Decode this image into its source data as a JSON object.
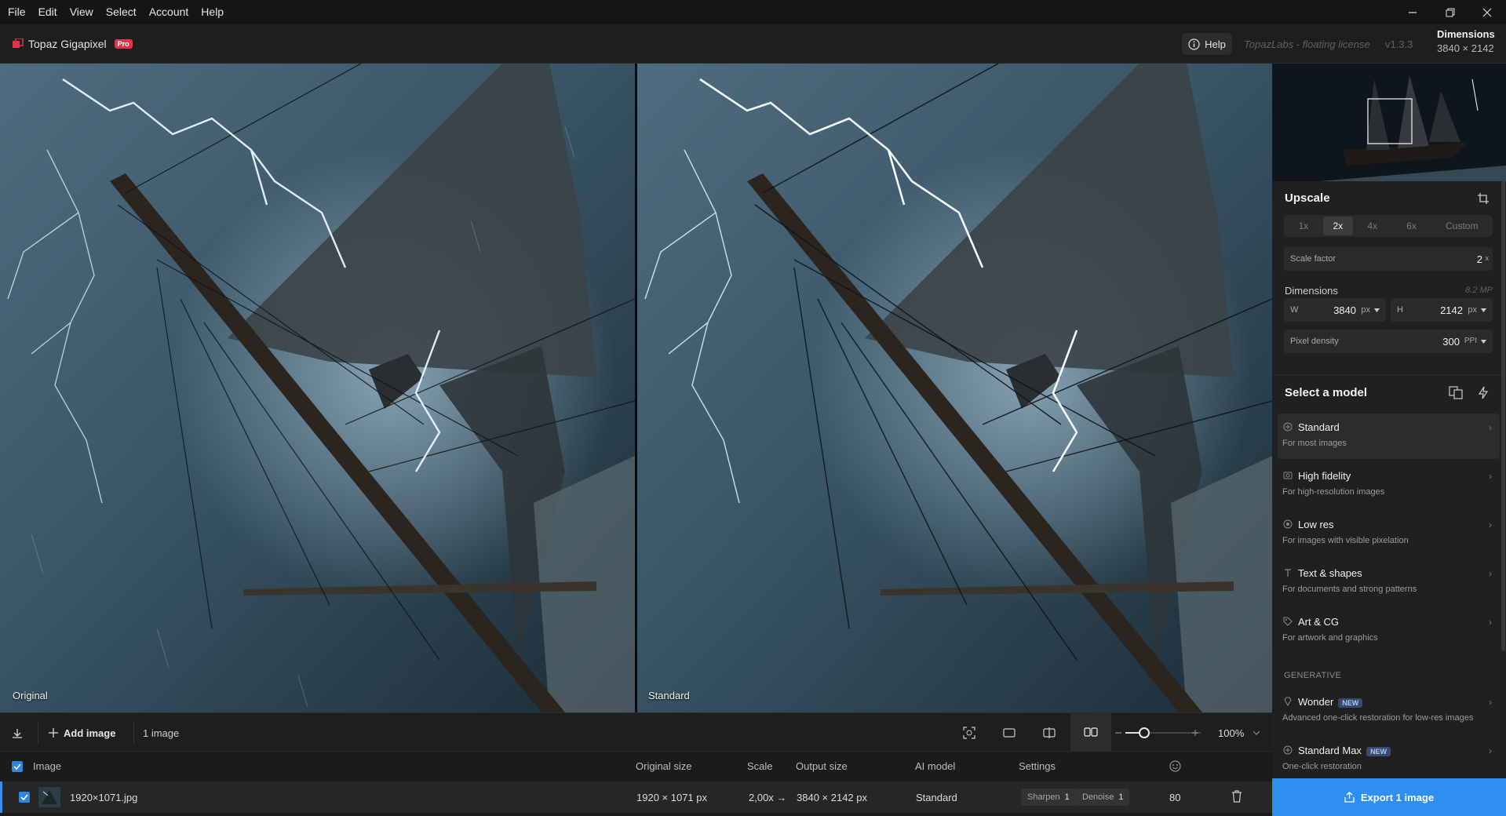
{
  "menu": [
    "File",
    "Edit",
    "View",
    "Select",
    "Account",
    "Help"
  ],
  "app": {
    "name": "Topaz Gigapixel",
    "badge": "Pro",
    "help": "Help",
    "license": "TopazLabs - floating license",
    "version": "v1.3.3"
  },
  "header_dims": {
    "title": "Dimensions",
    "value": "3840 × 2142"
  },
  "viewer": {
    "left_label": "Original",
    "right_label": "Standard"
  },
  "toolbar": {
    "add_image": "Add image",
    "count": "1 image",
    "zoom": "100%",
    "zoom_level": 0.25
  },
  "list": {
    "headers": {
      "image": "Image",
      "original_size": "Original size",
      "scale": "Scale",
      "output_size": "Output size",
      "ai_model": "AI model",
      "settings": "Settings"
    },
    "rows": [
      {
        "name": "1920×1071.jpg",
        "original_size": "1920 × 1071 px",
        "scale": "2,00x →",
        "output_size": "3840 × 2142 px",
        "model": "Standard",
        "sharpen_label": "Sharpen",
        "sharpen": "1",
        "denoise_label": "Denoise",
        "denoise": "1",
        "quality": "80"
      }
    ]
  },
  "panel": {
    "upscale_title": "Upscale",
    "scale_options": [
      "1x",
      "2x",
      "4x",
      "6x",
      "Custom"
    ],
    "scale_factor_label": "Scale factor",
    "scale_factor": "2",
    "scale_factor_unit": "x",
    "dims_label": "Dimensions",
    "megapixels": "8.2 MP",
    "w_label": "W",
    "w": "3840",
    "w_unit": "px",
    "h_label": "H",
    "h": "2142",
    "h_unit": "px",
    "density_label": "Pixel density",
    "density": "300",
    "density_unit": "PPI",
    "model_title": "Select a model",
    "models": [
      {
        "name": "Standard",
        "desc": "For most images"
      },
      {
        "name": "High fidelity",
        "desc": "For high-resolution images"
      },
      {
        "name": "Low res",
        "desc": "For images with visible pixelation"
      },
      {
        "name": "Text & shapes",
        "desc": "For documents and strong patterns"
      },
      {
        "name": "Art & CG",
        "desc": "For artwork and graphics"
      }
    ],
    "generative_label": "GENERATIVE",
    "gen_models": [
      {
        "name": "Wonder",
        "badge": "NEW",
        "desc": "Advanced one-click restoration for low-res images"
      },
      {
        "name": "Standard Max",
        "badge": "NEW",
        "desc": "One-click restoration"
      }
    ],
    "export": "Export 1 image"
  }
}
